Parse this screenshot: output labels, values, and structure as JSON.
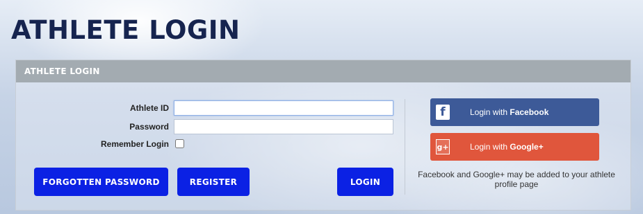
{
  "page": {
    "title": "ATHLETE LOGIN"
  },
  "panel": {
    "header": "ATHLETE LOGIN",
    "athlete_id_label": "Athlete ID",
    "athlete_id_value": "",
    "password_label": "Password",
    "password_value": "",
    "remember_label": "Remember Login",
    "remember_checked": false,
    "forgotten_password_label": "FORGOTTEN PASSWORD",
    "register_label": "REGISTER",
    "login_label": "LOGIN"
  },
  "social": {
    "facebook_prefix": "Login with ",
    "facebook_name": "Facebook",
    "facebook_icon": "facebook-icon",
    "facebook_color": "#3d5a98",
    "google_prefix": "Login with ",
    "google_name": "Google+",
    "google_icon": "google-plus-icon",
    "google_color": "#e0563c",
    "note": "Facebook and Google+ may be added to your athlete profile page"
  },
  "colors": {
    "title": "#16244f",
    "header_bar": "#a3abb1",
    "primary_button": "#0b21e4"
  }
}
